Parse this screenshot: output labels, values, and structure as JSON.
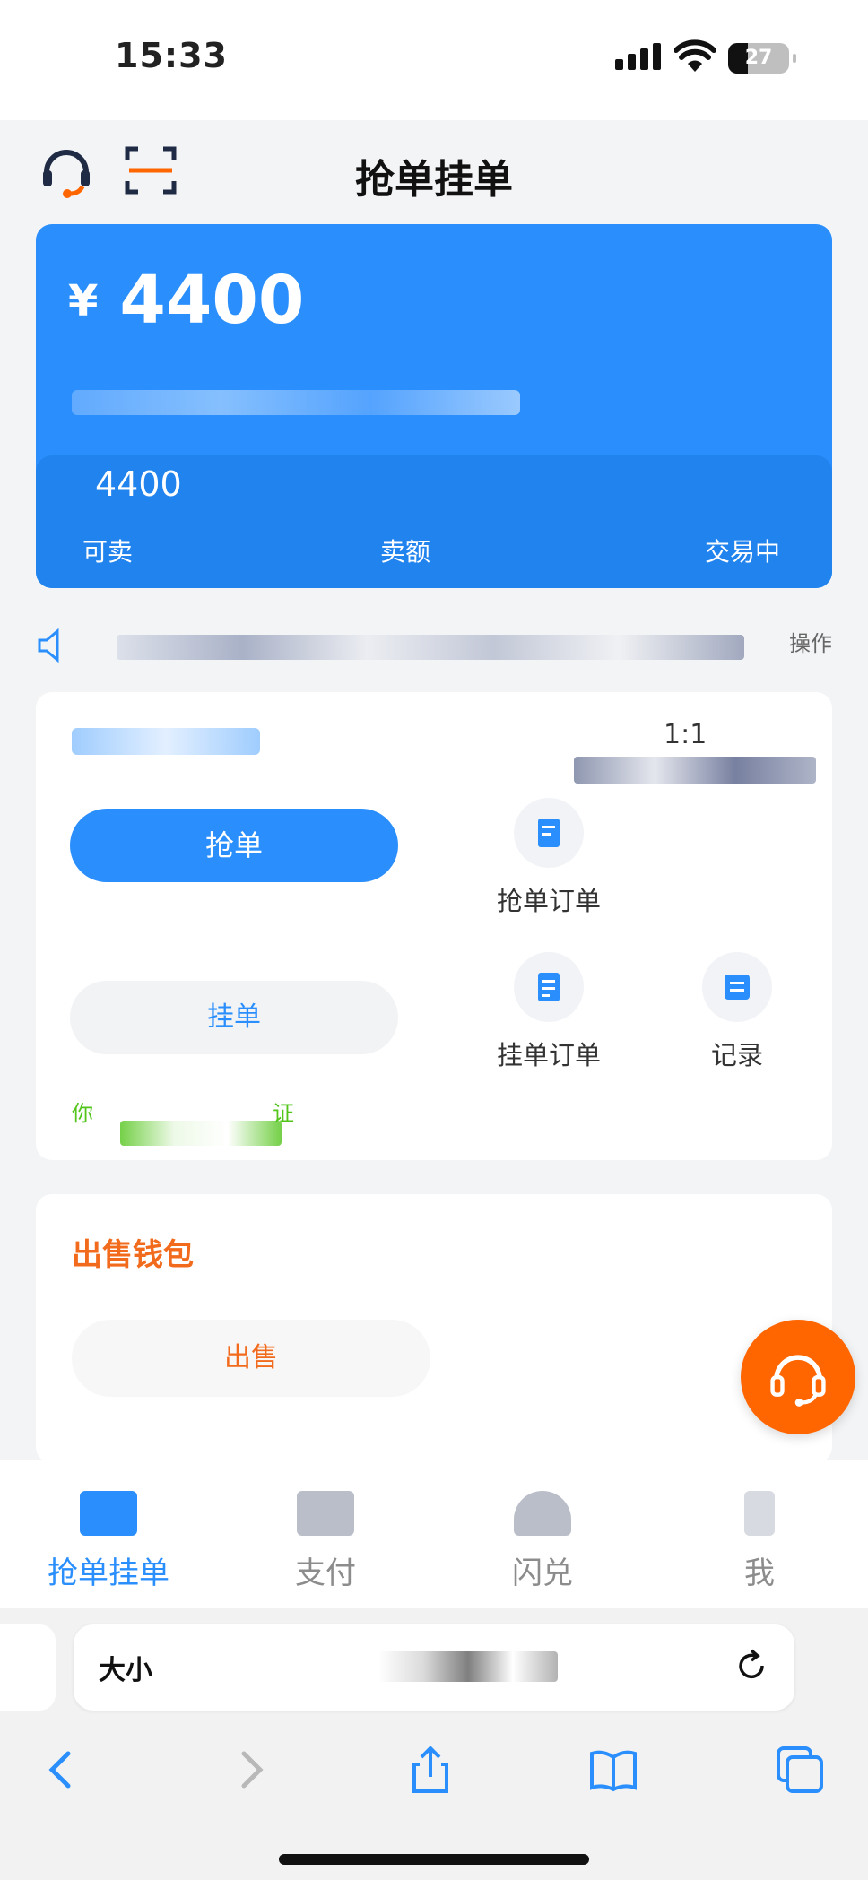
{
  "status_bar": {
    "time": "15:33",
    "battery": "27"
  },
  "header": {
    "title": "抢单挂单",
    "support_icon": "headset-icon",
    "scan_icon": "scan-icon"
  },
  "balance_card": {
    "currency_symbol": "¥",
    "amount": "4400",
    "available_value": "4400",
    "labels": {
      "available": "可卖",
      "amount": "卖额",
      "trading": "交易中"
    }
  },
  "notice": {
    "right_text": "操作"
  },
  "order_panel": {
    "ratio": "1:1",
    "primary_button": "抢单",
    "secondary_button": "挂单",
    "items": [
      {
        "label": "抢单订单",
        "icon": "order-icon"
      },
      {
        "label": "挂单订单",
        "icon": "list-icon"
      },
      {
        "label": "记录",
        "icon": "record-icon"
      }
    ],
    "tip_start": "你",
    "tip_end": "证"
  },
  "sell_panel": {
    "title": "出售钱包",
    "button": "出售"
  },
  "fab": {
    "icon": "headset-icon"
  },
  "tabbar": {
    "tabs": [
      {
        "label": "抢单挂单",
        "active": true
      },
      {
        "label": "支付",
        "active": false
      },
      {
        "label": "闪兑",
        "active": false
      },
      {
        "label": "我",
        "active": false
      }
    ]
  },
  "browser": {
    "text_size_label": "大小"
  },
  "colors": {
    "primary": "#2a8ffd",
    "accent": "#ff6600",
    "success": "#52c41a"
  }
}
